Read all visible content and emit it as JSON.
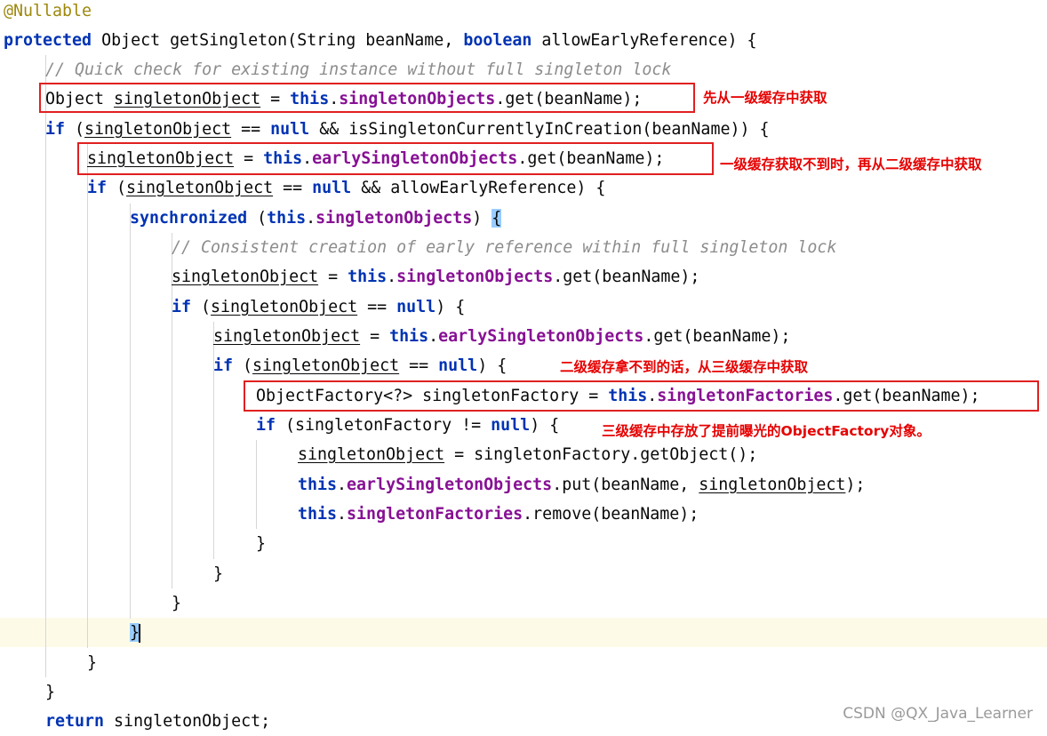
{
  "code": {
    "annotation": "@Nullable",
    "l2": {
      "kw": "protected",
      "t1": " Object getSingleton(String beanName, ",
      "kw2": "boolean",
      "t2": " allowEarlyReference) {"
    },
    "l3": {
      "comment": "// Quick check for existing instance without full singleton lock"
    },
    "l4": {
      "t1": "Object ",
      "var": "singletonObject",
      "t2": " = ",
      "kw": "this",
      "dot": ".",
      "fld": "singletonObjects",
      "t3": ".get(beanName);"
    },
    "l5": {
      "kw": "if",
      "t1": " (",
      "var": "singletonObject",
      "t2": " == ",
      "kw2": "null",
      "t3": " && isSingletonCurrentlyInCreation(beanName)) {"
    },
    "l6": {
      "var": "singletonObject",
      "t1": " = ",
      "kw": "this",
      "dot": ".",
      "fld": "earlySingletonObjects",
      "t2": ".get(beanName);"
    },
    "l7": {
      "kw": "if",
      "t1": " (",
      "var": "singletonObject",
      "t2": " == ",
      "kw2": "null",
      "t3": " && allowEarlyReference) {"
    },
    "l8": {
      "kw": "synchronized",
      "t1": " (",
      "kw2": "this",
      "dot": ".",
      "fld": "singletonObjects",
      "t2": ") ",
      "brace": "{"
    },
    "l9": {
      "comment": "// Consistent creation of early reference within full singleton lock"
    },
    "l10": {
      "var": "singletonObject",
      "t1": " = ",
      "kw": "this",
      "dot": ".",
      "fld": "singletonObjects",
      "t2": ".get(beanName);"
    },
    "l11": {
      "kw": "if",
      "t1": " (",
      "var": "singletonObject",
      "t2": " == ",
      "kw2": "null",
      "t3": ") {"
    },
    "l12": {
      "var": "singletonObject",
      "t1": " = ",
      "kw": "this",
      "dot": ".",
      "fld": "earlySingletonObjects",
      "t2": ".get(beanName);"
    },
    "l13": {
      "kw": "if",
      "t1": " (",
      "var": "singletonObject",
      "t2": " == ",
      "kw2": "null",
      "t3": ") {"
    },
    "l14": {
      "t1": "ObjectFactory<?> singletonFactory = ",
      "kw": "this",
      "dot": ".",
      "fld": "singletonFactories",
      "t2": ".get(beanName);"
    },
    "l15": {
      "kw": "if",
      "t1": " (singletonFactory != ",
      "kw2": "null",
      "t2": ") {"
    },
    "l16": {
      "var": "singletonObject",
      "t1": " = singletonFactory.getObject();"
    },
    "l17": {
      "kw": "this",
      "dot": ".",
      "fld": "earlySingletonObjects",
      "t1": ".put(beanName, ",
      "var": "singletonObject",
      "t2": ");"
    },
    "l18": {
      "kw": "this",
      "dot": ".",
      "fld": "singletonFactories",
      "t1": ".remove(beanName);"
    },
    "close": "}",
    "l27": {
      "kw": "return",
      "t1": " singletonObject;"
    }
  },
  "notes": {
    "n1": "先从一级缓存中获取",
    "n2": "一级缓存获取不到时，再从二级缓存中获取",
    "n3": "二级缓存拿不到的话，从三级缓存中获取",
    "n4": "三级缓存中存放了提前曝光的ObjectFactory对象。"
  },
  "watermark": "CSDN @QX_Java_Learner",
  "colors": {
    "keyword": "#0033b3",
    "field": "#871094",
    "comment": "#8c8c8c",
    "annotation": "#9e880d",
    "box": "#e02020",
    "note": "#e60000",
    "caret_line": "#fdfbe8"
  }
}
